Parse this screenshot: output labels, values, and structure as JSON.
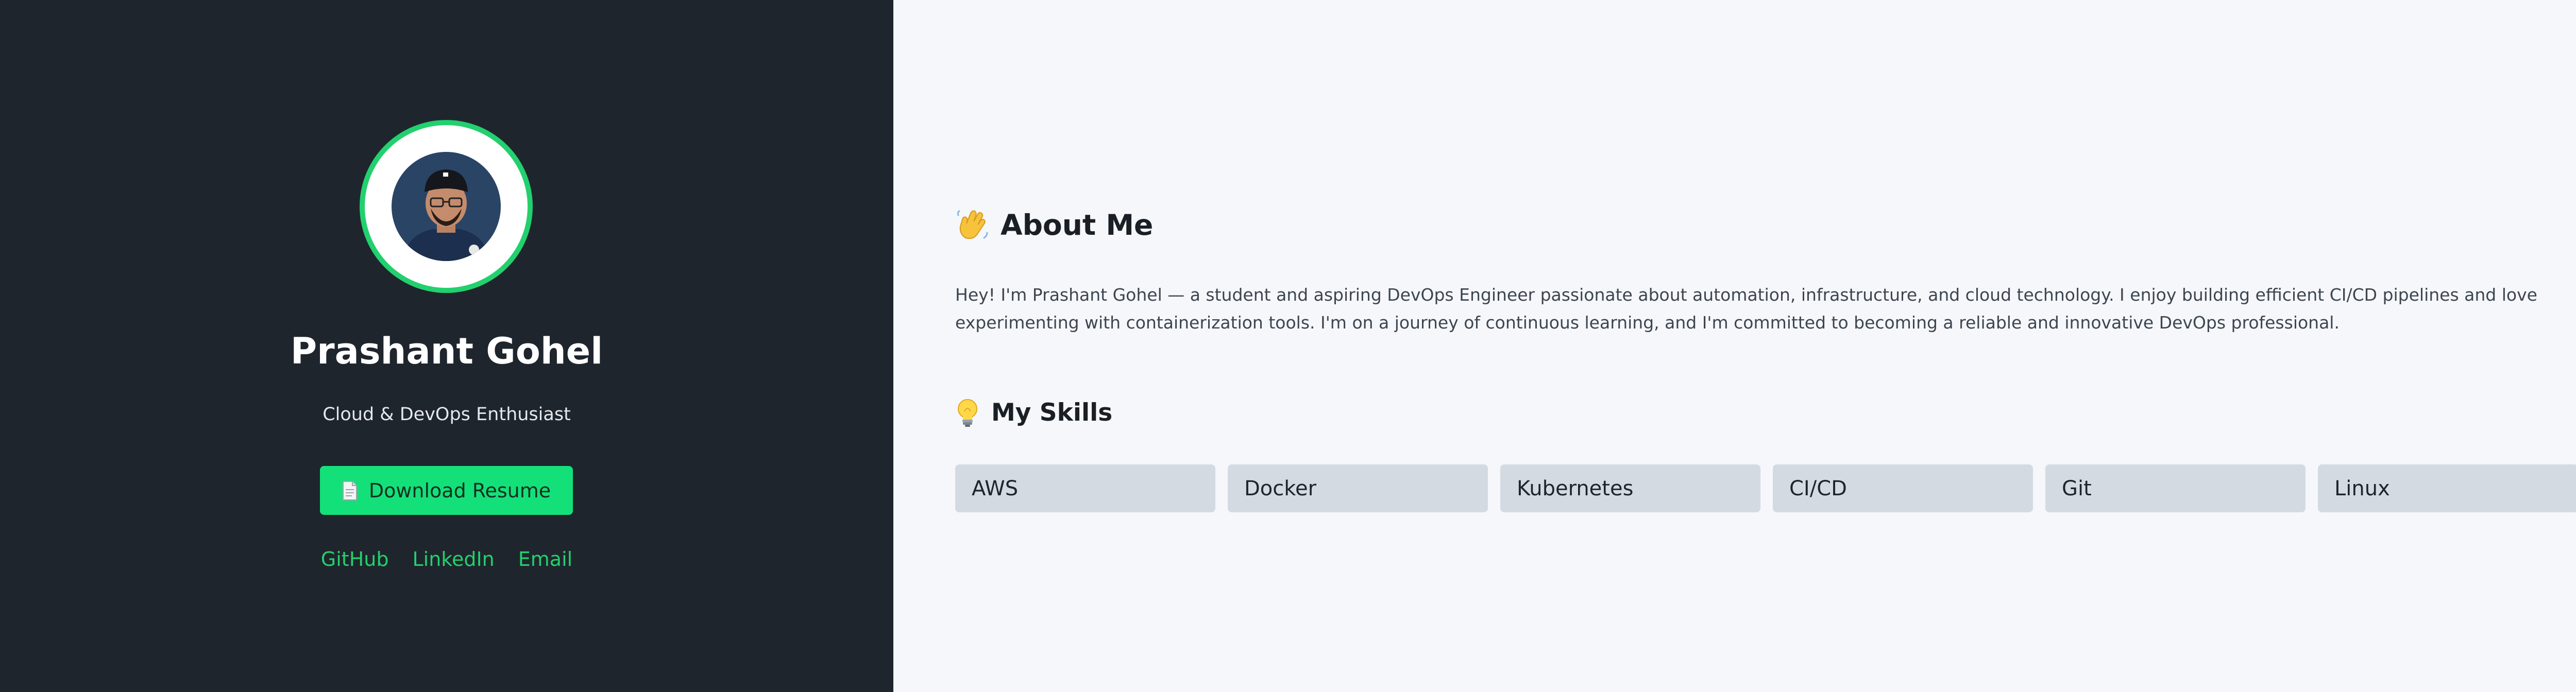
{
  "sidebar": {
    "name": "Prashant Gohel",
    "tagline": "Cloud & DevOps Enthusiast",
    "resume_button": {
      "icon": "document-icon",
      "label": "Download Resume"
    },
    "links": [
      {
        "label": "GitHub"
      },
      {
        "label": "LinkedIn"
      },
      {
        "label": "Email"
      }
    ]
  },
  "main": {
    "about": {
      "icon": "waving-hand-icon",
      "title": "About Me",
      "text": "Hey! I'm Prashant Gohel — a student and aspiring DevOps Engineer passionate about automation, infrastructure, and cloud technology. I enjoy building efficient CI/CD pipelines and love experimenting with containerization tools. I'm on a journey of continuous learning, and I'm committed to becoming a reliable and innovative DevOps professional."
    },
    "skills": {
      "icon": "light-bulb-icon",
      "title": "My Skills",
      "items": [
        "AWS",
        "Docker",
        "Kubernetes",
        "CI/CD",
        "Git",
        "Linux"
      ]
    }
  },
  "colors": {
    "sidebar_bg": "#1f252d",
    "main_bg": "#f5f7fa",
    "accent": "#14e07a",
    "link": "#22d06e",
    "skill_bg": "#d3dae2"
  }
}
